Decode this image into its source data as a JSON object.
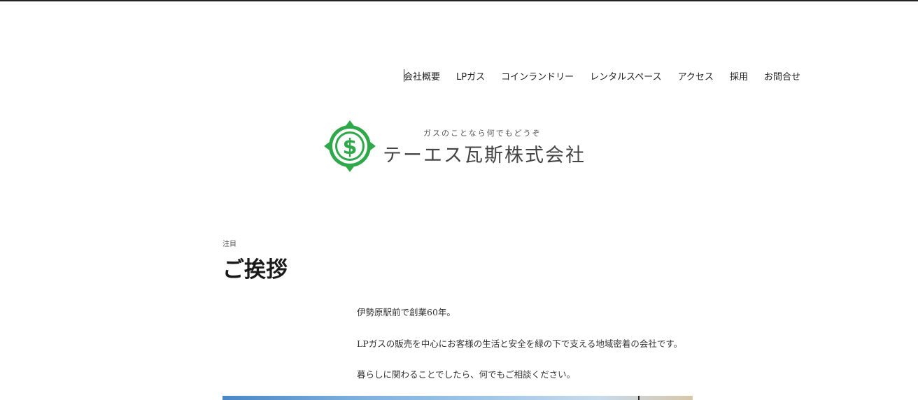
{
  "nav": {
    "items": [
      "会社概要",
      "LPガス",
      "コインランドリー",
      "レンタルスペース",
      "アクセス",
      "採用",
      "お問合せ"
    ]
  },
  "logo": {
    "tagline": "ガスのことなら何でもどうぞ",
    "company": "テーエス瓦斯株式会社",
    "brand_color": "#2fa84a"
  },
  "section": {
    "eyebrow": "注目",
    "title": "ご挨拶",
    "paragraphs": [
      "伊勢原駅前で創業60年。",
      "LPガスの販売を中心にお客様の生活と安全を緑の下で支える地域密着の会社です。",
      "暮らしに関わることでしたら、何でもご相談ください。"
    ]
  }
}
